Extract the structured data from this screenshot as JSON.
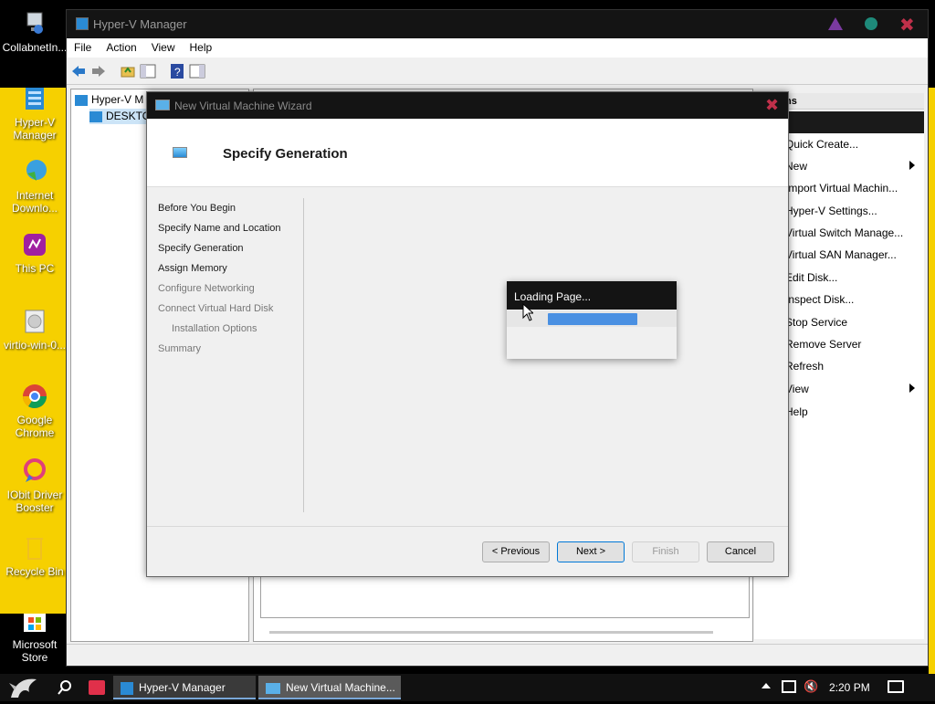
{
  "desktop": {
    "icons": [
      {
        "label": "CollabnetIn..."
      },
      {
        "label": "Hyper-V Manager"
      },
      {
        "label": "Internet Downlo..."
      },
      {
        "label": "This PC"
      },
      {
        "label": "virtio-win-0..."
      },
      {
        "label": "Google Chrome"
      },
      {
        "label": "IObit Driver Booster"
      },
      {
        "label": "Recycle Bin"
      },
      {
        "label": "Microsoft Store"
      }
    ]
  },
  "hv": {
    "title": "Hyper-V Manager",
    "menu": [
      "File",
      "Action",
      "View",
      "Help"
    ],
    "tree": {
      "root": "Hyper-V M",
      "child": "DESKTO"
    },
    "actions_header": "ns",
    "actions": [
      "Quick Create...",
      "New",
      "Import Virtual Machin...",
      "Hyper-V Settings...",
      "Virtual Switch Manage...",
      "Virtual SAN Manager...",
      "Edit Disk...",
      "Inspect Disk...",
      "Stop Service",
      "Remove Server",
      "Refresh",
      "View",
      "Help"
    ]
  },
  "wizard": {
    "title": "New Virtual Machine Wizard",
    "heading": "Specify Generation",
    "steps": [
      {
        "label": "Before You Begin",
        "enabled": true
      },
      {
        "label": "Specify Name and Location",
        "enabled": true
      },
      {
        "label": "Specify Generation",
        "enabled": true
      },
      {
        "label": "Assign Memory",
        "enabled": true
      },
      {
        "label": "Configure Networking",
        "enabled": false
      },
      {
        "label": "Connect Virtual Hard Disk",
        "enabled": false
      },
      {
        "label": "Installation Options",
        "enabled": false
      },
      {
        "label": "Summary",
        "enabled": false
      }
    ],
    "buttons": {
      "previous": "< Previous",
      "next": "Next >",
      "finish": "Finish",
      "cancel": "Cancel"
    },
    "loading": {
      "text": "Loading Page..."
    }
  },
  "taskbar": {
    "items": [
      "Hyper-V Manager",
      "New Virtual Machine..."
    ],
    "time": "2:20 PM"
  },
  "colors": {
    "desktop": "#f6d000",
    "accent": "#0078d7",
    "titlebar": "#141414"
  }
}
